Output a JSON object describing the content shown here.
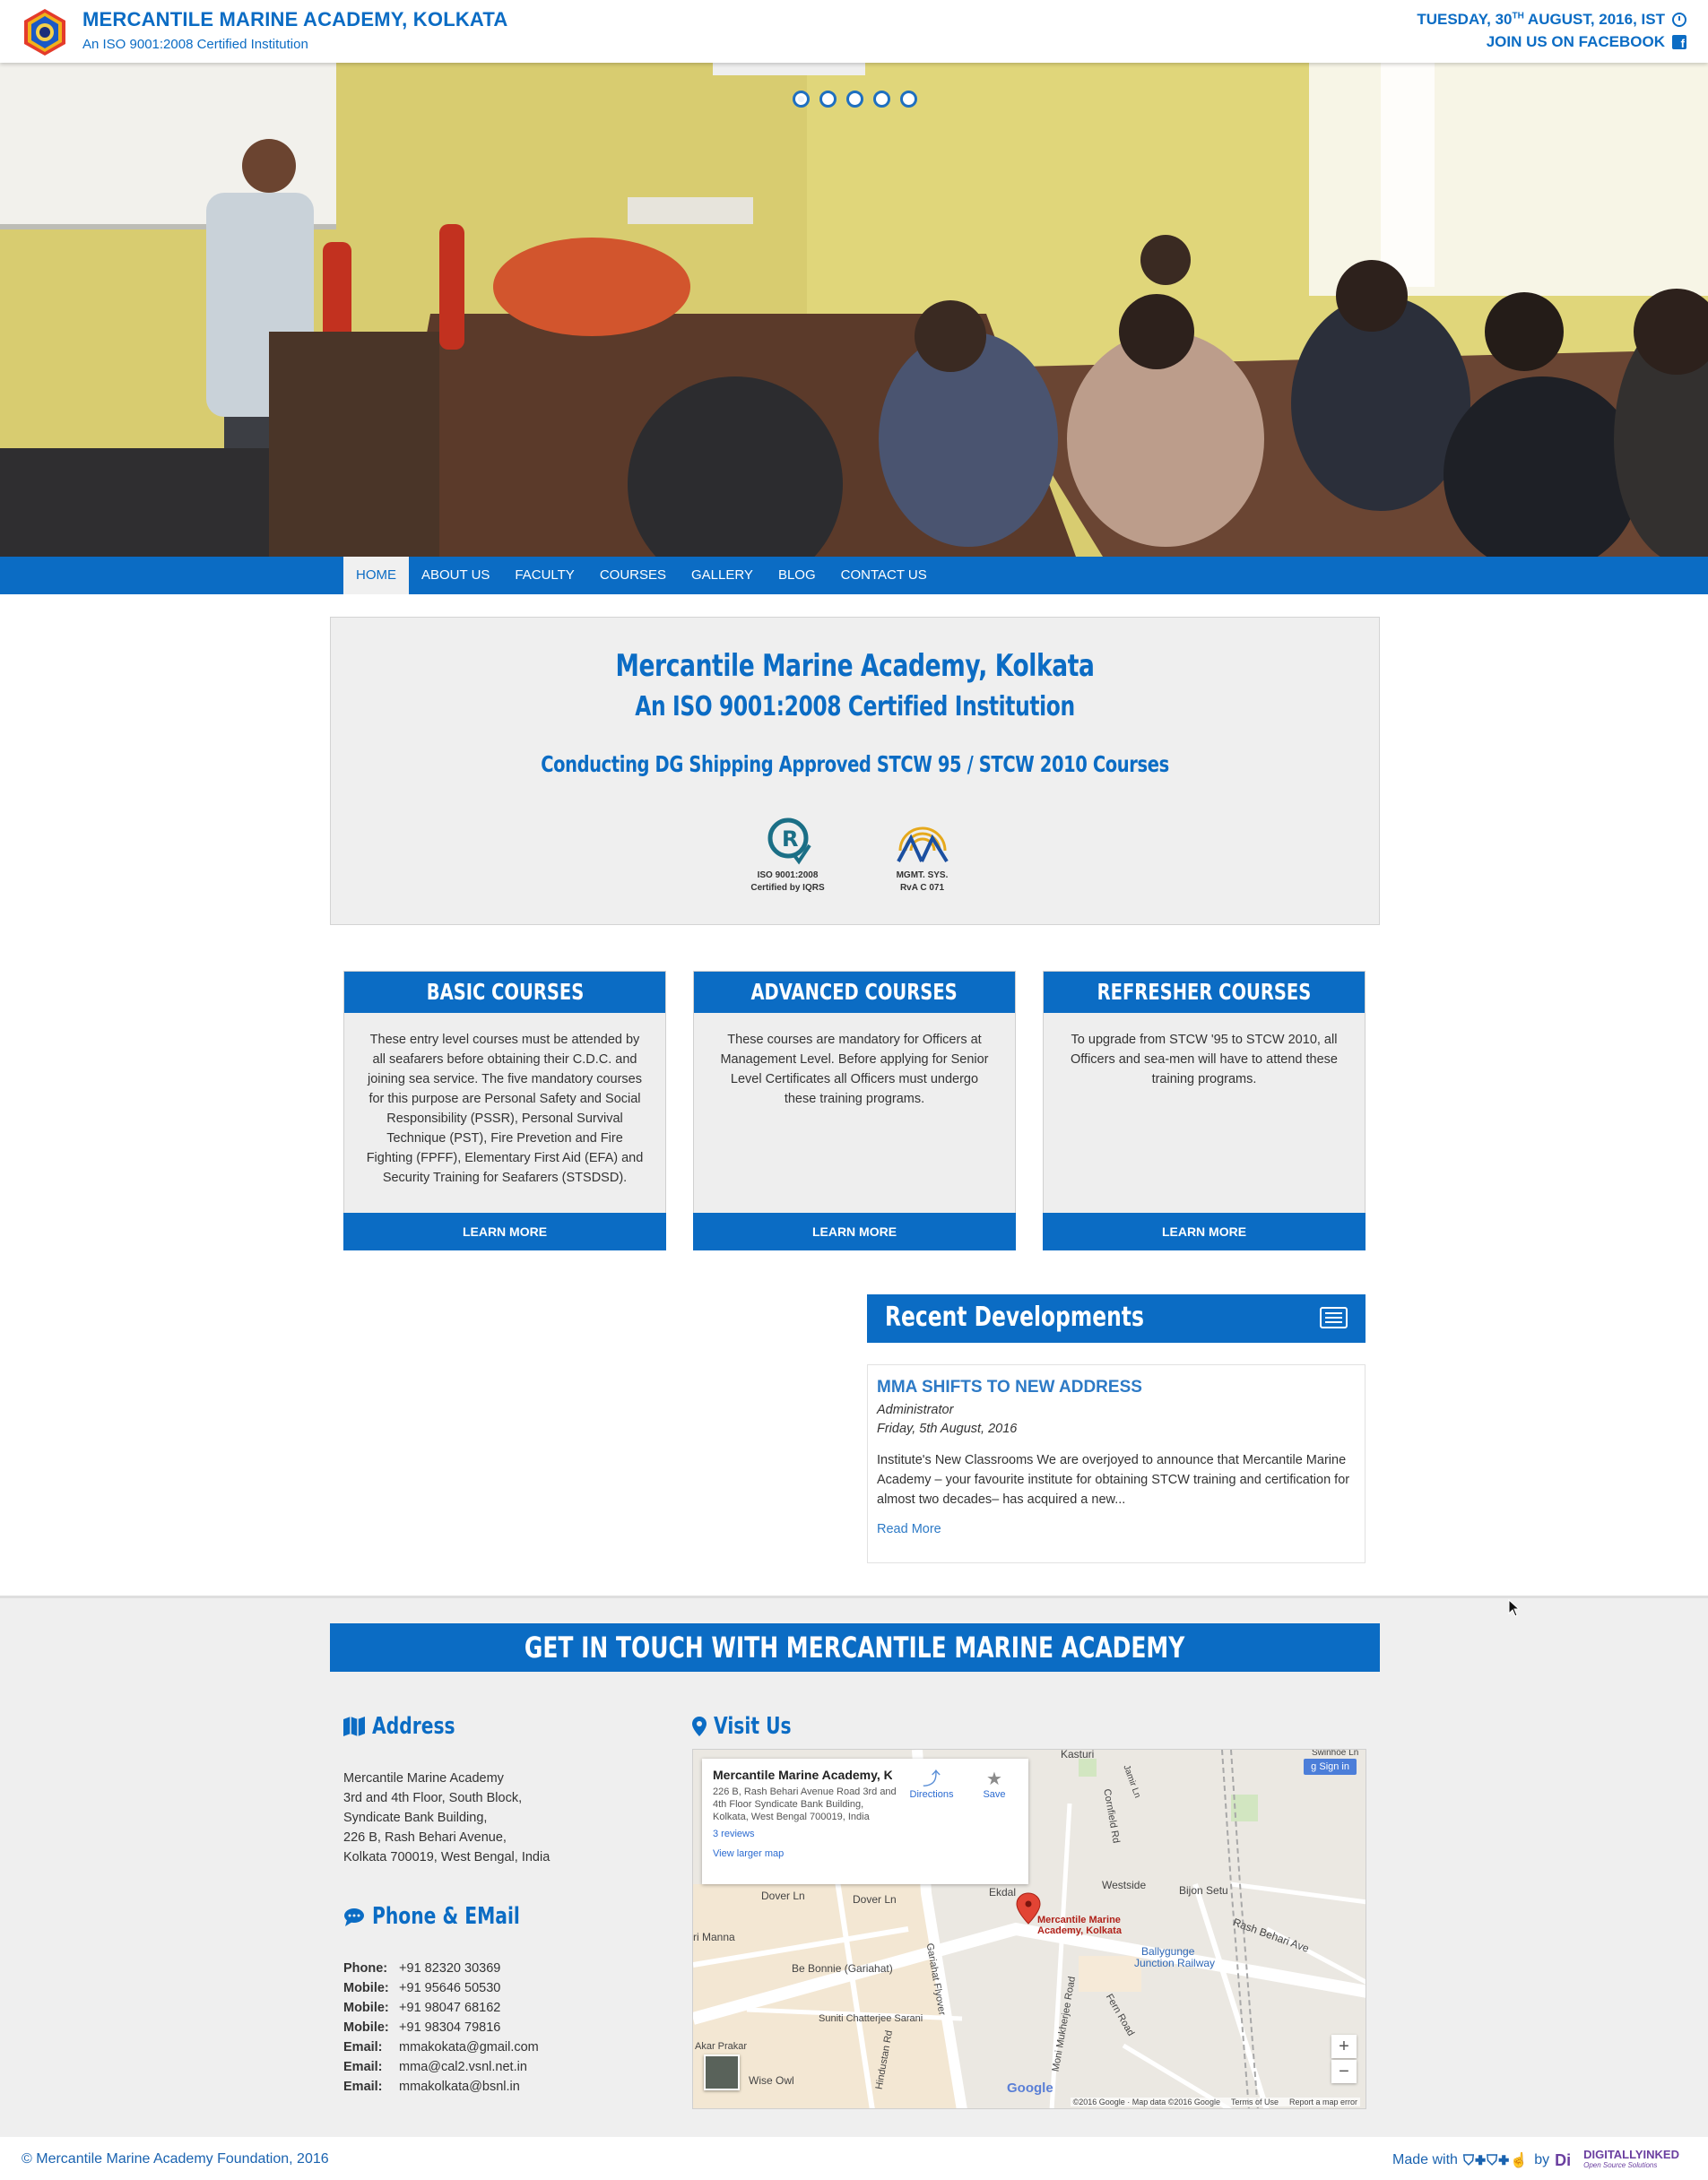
{
  "header": {
    "title": "MERCANTILE MARINE ACADEMY, KOLKATA",
    "subtitle": "An ISO 9001:2008 Certified Institution",
    "date_main": "TUESDAY, 30",
    "date_sup": "TH",
    "date_rest": " AUGUST, 2016, IST",
    "facebook_label": "JOIN US ON FACEBOOK"
  },
  "slider": {
    "slide_count": 5,
    "active_index": 0
  },
  "nav": {
    "items": [
      "HOME",
      "ABOUT US",
      "FACULTY",
      "COURSES",
      "GALLERY",
      "BLOG",
      "CONTACT US"
    ],
    "active": "HOME"
  },
  "intro": {
    "heading": "Mercantile Marine Academy, Kolkata",
    "subheading": "An ISO 9001:2008 Certified Institution",
    "tagline": "Conducting DG Shipping Approved STCW 95 / STCW 2010 Courses",
    "certs": [
      {
        "line1": "ISO 9001:2008",
        "line2": "Certified by IQRS"
      },
      {
        "line1": "MGMT. SYS.",
        "line2": "RvA C 071"
      }
    ]
  },
  "courses": [
    {
      "title": "BASIC COURSES",
      "body": "These entry level courses must be attended by all seafarers before obtaining their C.D.C. and joining sea service. The five mandatory courses for this purpose are Personal Safety and Social Responsibility (PSSR), Personal Survival Technique (PST), Fire Prevetion and Fire Fighting (FPFF), Elementary First Aid (EFA) and Security Training for Seafarers (STSDSD).",
      "button": "LEARN MORE"
    },
    {
      "title": "ADVANCED COURSES",
      "body": "These courses are mandatory for Officers at Management Level. Before applying for Senior Level Certificates all Officers must undergo these training programs.",
      "button": "LEARN MORE"
    },
    {
      "title": "REFRESHER COURSES",
      "body": "To upgrade from STCW '95 to STCW 2010, all Officers and sea-men will have to attend these training programs.",
      "button": "LEARN MORE"
    }
  ],
  "recent": {
    "heading": "Recent Developments",
    "post_title": "MMA SHIFTS TO NEW ADDRESS",
    "author": "Administrator",
    "date": "Friday, 5th August, 2016",
    "excerpt": "Institute's New Classrooms We are overjoyed to announce that Mercantile Marine Academy – your favourite institute for obtaining STCW training and certification for almost two decades– has acquired a new...",
    "read_more": "Read More"
  },
  "contact": {
    "banner": "GET IN TOUCH WITH MERCANTILE MARINE ACADEMY",
    "address_heading": "Address",
    "address_lines": [
      "Mercantile Marine Academy",
      "3rd and 4th Floor, South Block,",
      "Syndicate Bank Building,",
      "226 B, Rash Behari Avenue,",
      "Kolkata 700019, West Bengal, India"
    ],
    "phone_heading": "Phone & EMail",
    "phones": [
      {
        "label": "Phone:",
        "value": "+91 82320 30369"
      },
      {
        "label": "Mobile:",
        "value": "+91 95646 50530"
      },
      {
        "label": "Mobile:",
        "value": "+91 98047 68162"
      },
      {
        "label": "Mobile:",
        "value": "+91 98304 79816"
      },
      {
        "label": "Email:",
        "value": "mmakokata@gmail.com"
      },
      {
        "label": "Email:",
        "value": "mma@cal2.vsnl.net.in"
      },
      {
        "label": "Email:",
        "value": "mmakolkata@bsnl.in"
      }
    ],
    "visit_heading": "Visit Us"
  },
  "map": {
    "place_name": "Mercantile Marine Academy, K...",
    "place_address": "226 B, Rash Behari Avenue Road 3rd and 4th Floor Syndicate Bank Building, Kolkata, West Bengal 700019, India",
    "reviews": "3 reviews",
    "larger_map": "View larger map",
    "directions": "Directions",
    "save": "Save",
    "sign_in": "Sign in",
    "pin_label_1": "Mercantile Marine",
    "pin_label_2": "Academy, Kolkata",
    "labels": {
      "kasturi": "Kasturi",
      "westside": "Westside",
      "bijon_setu": "Bijon Setu",
      "rash_behari_ave": "Rash Behari Ave",
      "ballygunge": "Ballygunge",
      "junction_railway": "Junction Railway",
      "dover_ln_1": "Dover Ln",
      "dover_ln_2": "Dover Ln",
      "ekdalia": "Ekdal",
      "manna": "ri Manna",
      "be_bonnie": "Be Bonnie (Gariahat)",
      "suniti": "Suniti Chatterjee Sarani",
      "akar_prakar": "Akar Prakar",
      "wise_owl": "Wise Owl",
      "cornfield": "Cornfield Rd",
      "jamir": "Jamir Ln",
      "fern_road": "Fern Road",
      "moni": "Moni Mukherjee Road",
      "hindustan": "Hindustan Rd",
      "gariahat_flyover": "Gariahat Flyover",
      "swinhoe": "Swinhoe Ln"
    },
    "google": "Google",
    "attribution": "©2016 Google · Map data ©2016 Google",
    "terms": "Terms of Use",
    "report": "Report a map error"
  },
  "footer": {
    "copyright": "© Mercantile Marine Academy Foundation, 2016",
    "made_with": "Made with",
    "by": "by",
    "brand": "DIGITALLYINKED",
    "brand_tag": "Open Source Solutions"
  }
}
